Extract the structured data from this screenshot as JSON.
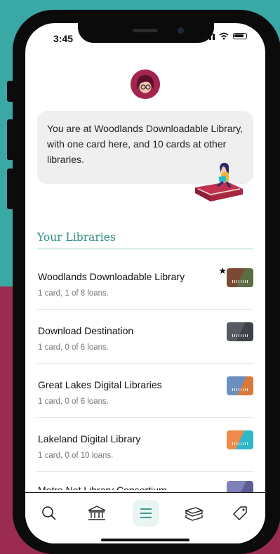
{
  "status": {
    "time": "3:45"
  },
  "intro": {
    "message": "You are at Woodlands Downloadable Library, with one card here, and 10 cards at other libraries."
  },
  "libraries_section": {
    "title": "Your Libraries",
    "items": [
      {
        "name": "Woodlands Downloadable Library",
        "subtitle": "1 card, 1 of 8 loans.",
        "starred": true,
        "card_colors": [
          "#7a4a32",
          "#5b6e43"
        ]
      },
      {
        "name": "Download Destination",
        "subtitle": "1 card, 0 of 6 loans.",
        "starred": false,
        "card_colors": [
          "#555a63",
          "#3e434b"
        ]
      },
      {
        "name": "Great Lakes Digital Libraries",
        "subtitle": "1 card, 0 of 6 loans.",
        "starred": false,
        "card_colors": [
          "#6b8fbf",
          "#d97a3c"
        ]
      },
      {
        "name": "Lakeland Digital Library",
        "subtitle": "1 card, 0 of 10 loans.",
        "starred": false,
        "card_colors": [
          "#f08a4b",
          "#2eb8c8"
        ]
      },
      {
        "name": "Metro Net Library Consortium",
        "subtitle": "",
        "starred": false,
        "card_colors": [
          "#7d82b8",
          "#5a5e90"
        ]
      }
    ]
  },
  "tabbar": {
    "tabs": [
      {
        "icon": "search-icon"
      },
      {
        "icon": "library-building-icon"
      },
      {
        "icon": "menu-lines-icon",
        "active": true
      },
      {
        "icon": "books-stack-icon"
      },
      {
        "icon": "tag-icon"
      }
    ]
  },
  "colors": {
    "accent": "#2f8e86",
    "background_top": "#3aa9a6",
    "background_bottom": "#9c2b52",
    "avatar": "#a3254d"
  }
}
